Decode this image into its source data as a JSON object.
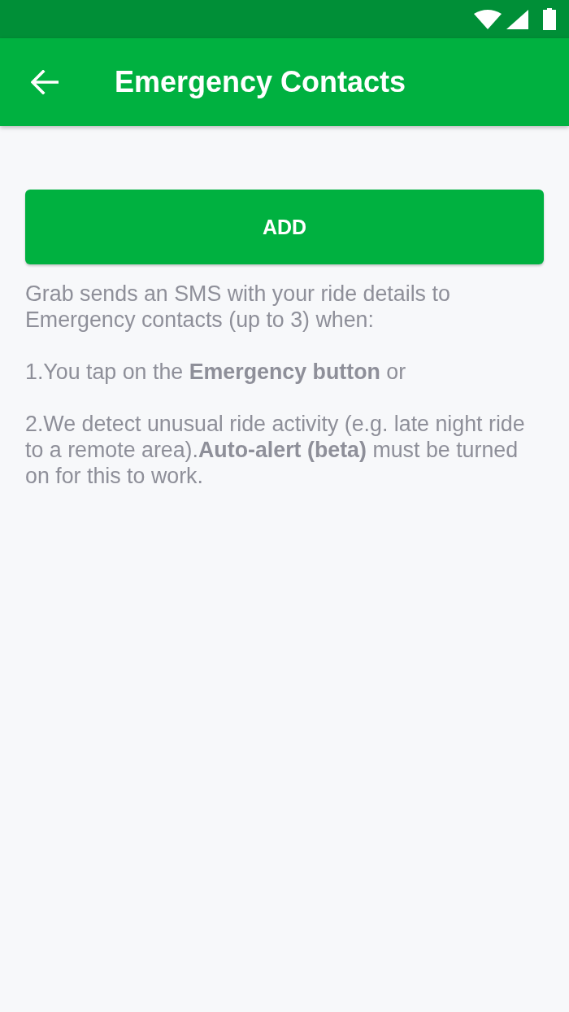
{
  "app_bar": {
    "title": "Emergency Contacts"
  },
  "add_button": {
    "label": "ADD"
  },
  "description": [
    "Grab sends an SMS with your ride details to Emergency contacts (up to 3) when:",
    "1.You tap on the **Emergency button** or",
    "2.We detect unusual ride activity (e.g. late night ride to a remote area).**Auto-alert (beta)** must be turned on for this to work."
  ]
}
